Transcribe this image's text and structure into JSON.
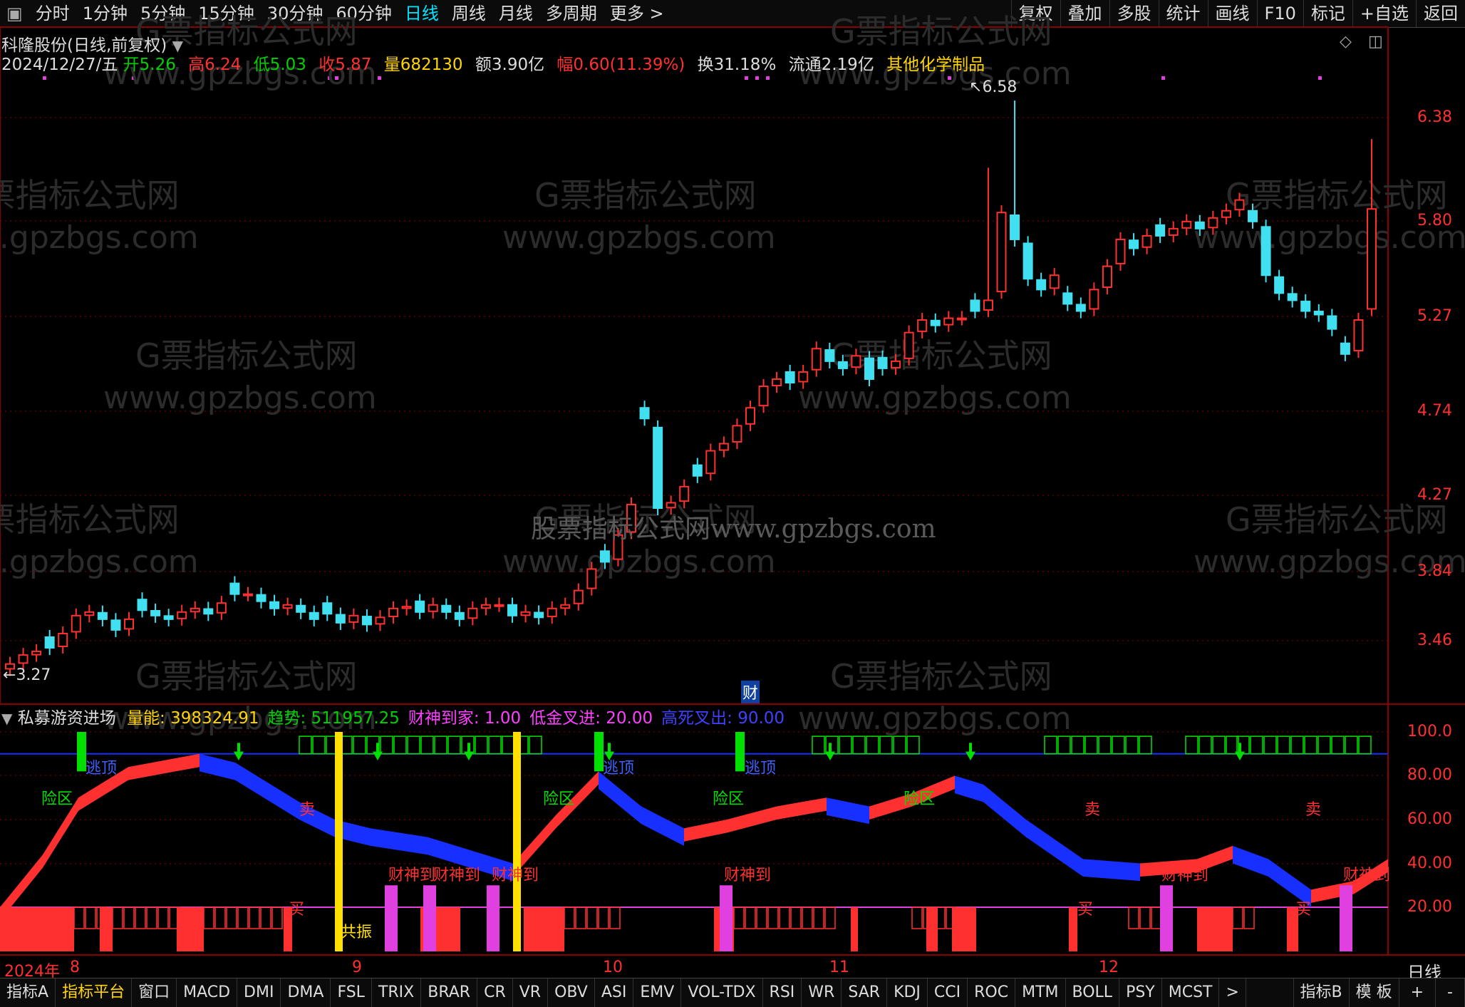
{
  "toolbar": {
    "periods": [
      "分时",
      "1分钟",
      "5分钟",
      "15分钟",
      "30分钟",
      "60分钟",
      "日线",
      "周线",
      "月线",
      "多周期",
      "更多 >"
    ],
    "active_period": "日线",
    "right": [
      "复权",
      "叠加",
      "多股",
      "统计",
      "画线",
      "F10",
      "标记",
      "+自选",
      "返回"
    ]
  },
  "header": {
    "stock": "科隆股份(日线,前复权)",
    "date": "2024/12/27/五",
    "open_label": "开",
    "open": "5.26",
    "high_label": "高",
    "high": "6.24",
    "low_label": "低",
    "low": "5.03",
    "close_label": "收",
    "close": "5.87",
    "vol_label": "量",
    "vol": "682130",
    "amount": "额3.90亿",
    "change": "幅0.60(11.39%)",
    "turnover": "换31.18%",
    "float": "流通2.19亿",
    "sector": "其他化学制品"
  },
  "price_axis": [
    "6.38",
    "5.80",
    "5.27",
    "4.74",
    "4.27",
    "3.84",
    "3.46"
  ],
  "annotations": {
    "max_label": "6.58",
    "min_label": "3.27",
    "cai_marker": "财",
    "watermark_center": "股票指标公式网www.gpzbgs.com"
  },
  "watermarks": [
    "G票指标公式网",
    "www.gpzbgs.com"
  ],
  "indicator": {
    "name": "私募游资进场",
    "items": [
      {
        "label": "量能: ",
        "value": "398324.91",
        "color": "#ffd400"
      },
      {
        "label": "趋势: ",
        "value": "511957.25",
        "color": "#00d000"
      },
      {
        "label": "财神到家: ",
        "value": "1.00",
        "color": "#ff40ff"
      },
      {
        "label": "低金叉进: ",
        "value": "20.00",
        "color": "#ff40ff"
      },
      {
        "label": "高死叉出: ",
        "value": "90.00",
        "color": "#4040ff"
      }
    ],
    "axis": [
      "100.0",
      "80.00",
      "60.00",
      "40.00",
      "20.00"
    ],
    "labels": {
      "escape": "逃顶",
      "danger": "险区",
      "sell": "卖",
      "buy": "买",
      "caishen": "财神到",
      "resonance": "共振"
    }
  },
  "time_axis": {
    "labels": [
      "2024年",
      "8",
      "9",
      "10",
      "11",
      "12"
    ],
    "period_label": "日线"
  },
  "bottom_tabs": [
    "指标A",
    "指标平台",
    "窗口",
    "MACD",
    "DMI",
    "DMA",
    "FSL",
    "TRIX",
    "BRAR",
    "CR",
    "VR",
    "OBV",
    "ASI",
    "EMV",
    "VOL-TDX",
    "RSI",
    "WR",
    "SAR",
    "KDJ",
    "CCI",
    "ROC",
    "MTM",
    "BOLL",
    "PSY",
    "MCST",
    ">"
  ],
  "bottom_right": [
    "指标B",
    "模 板",
    "+",
    "-"
  ],
  "colors": {
    "up": "#ff3030",
    "down": "#40e0f0",
    "grid": "#8a0000",
    "green": "#00e000",
    "yellow": "#ffe000",
    "magenta": "#e040e0",
    "blue": "#1830ff"
  }
}
